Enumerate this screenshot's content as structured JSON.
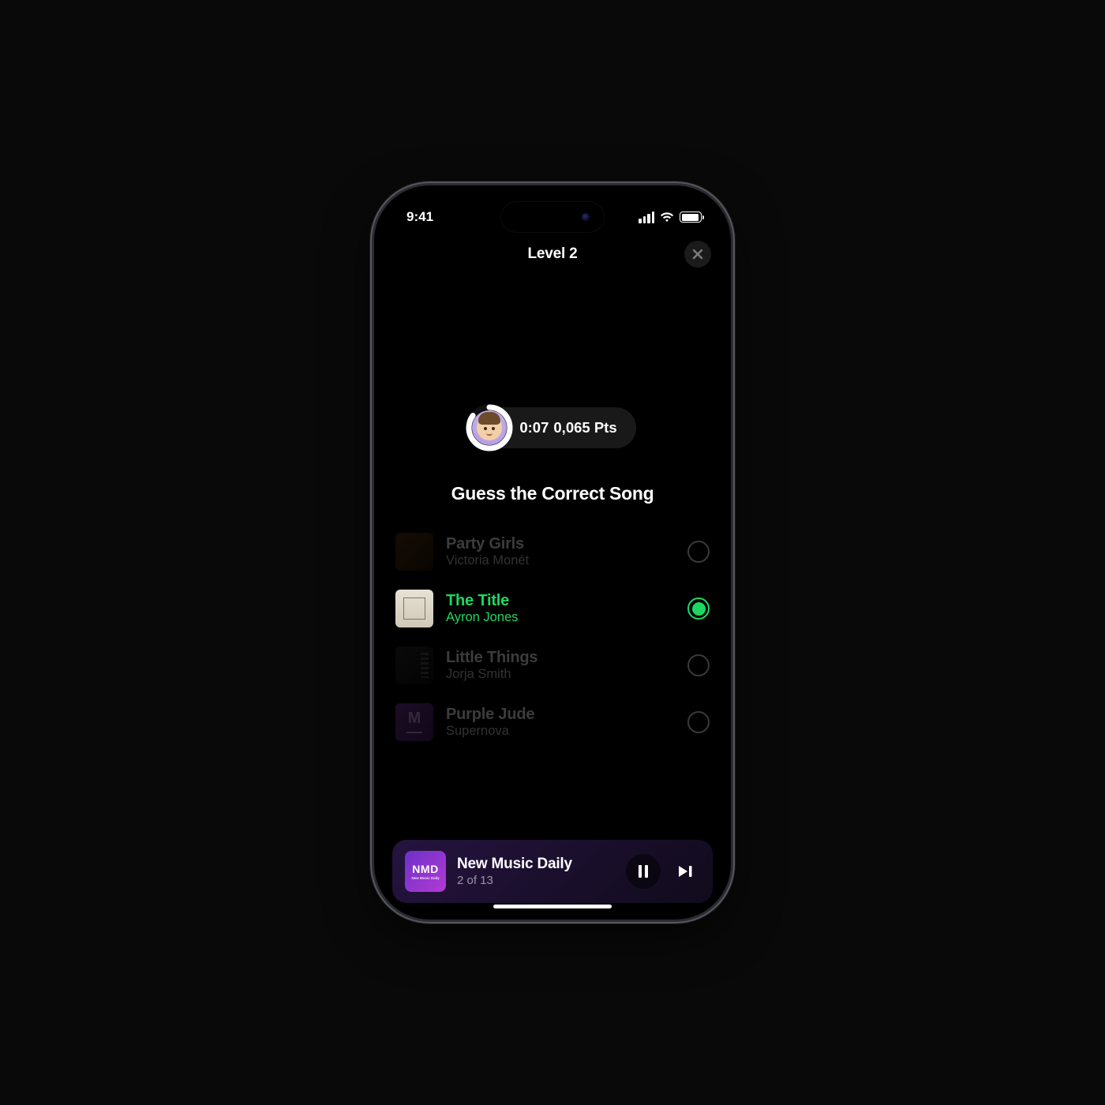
{
  "status": {
    "time": "9:41"
  },
  "header": {
    "title": "Level 2"
  },
  "timer": {
    "elapsed": "0:07",
    "points": "0,065 Pts",
    "progress": 0.85
  },
  "prompt": "Guess the Correct Song",
  "accent": "#1ED760",
  "options": [
    {
      "song": "Party Girls",
      "artist": "Victoria Monét",
      "state": "dim"
    },
    {
      "song": "The Title",
      "artist": "Ayron Jones",
      "state": "sel"
    },
    {
      "song": "Little Things",
      "artist": "Jorja Smith",
      "state": "dim"
    },
    {
      "song": "Purple Jude",
      "artist": "Supernova",
      "state": "dim"
    }
  ],
  "player": {
    "art_label": "NMD",
    "art_sub": "New Music Daily",
    "title": "New Music Daily",
    "subtitle": "2 of 13"
  }
}
